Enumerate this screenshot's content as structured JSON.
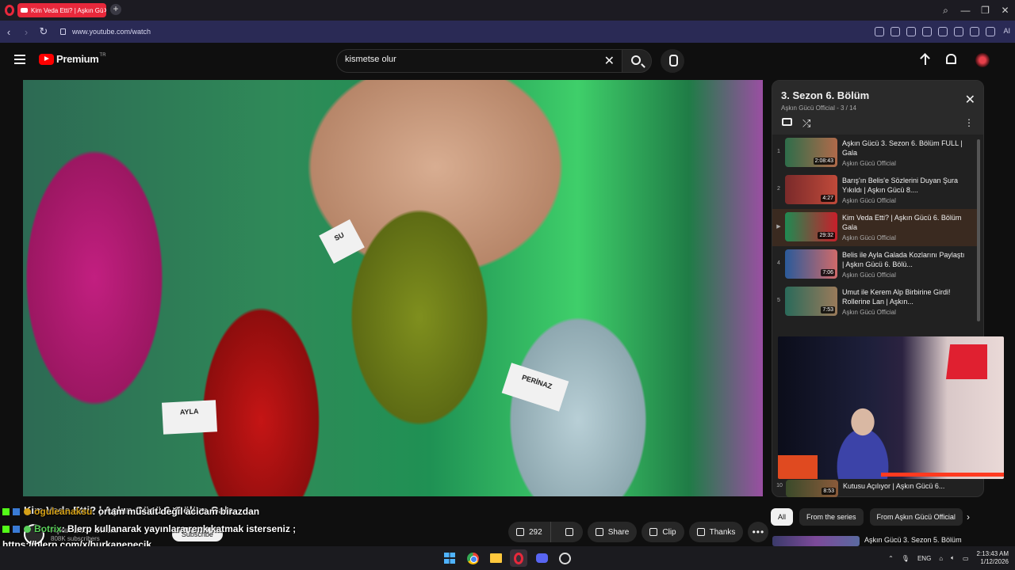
{
  "browser": {
    "tab_title": "Kim Veda Etti? | Aşkın Gü",
    "url": "www.youtube.com/watch",
    "ai_label": "AI"
  },
  "header": {
    "logo_text": "Premium",
    "logo_region": "TR",
    "search_value": "kismetse olur"
  },
  "video": {
    "name_tags": [
      "AYLA",
      "PERİNAZ",
      "SU"
    ],
    "title": "Kim Veda Etti? | Aşkın Gücü 6. Bölüm Gala",
    "channel_name": "Aşkın Gücü Official",
    "subscribers": "808K subscribers",
    "subscribe_label": "Subscribe"
  },
  "chat": [
    {
      "user": "oguleanaksu",
      "message": ": ortam müsait değil acicam birazdan"
    },
    {
      "user": "Botrix",
      "message": ": Blerp kullanarak yayınlara renk katmak isterseniz ;"
    }
  ],
  "chat_link": "https://blerp.com/x/hurkanepecik",
  "actions": {
    "like_count": "292",
    "share_label": "Share",
    "clip_label": "Clip",
    "thanks_label": "Thanks"
  },
  "playlist": {
    "title": "3. Sezon 6. Bölüm",
    "subtitle": "Aşkın Gücü Official - 3 / 14",
    "items": [
      {
        "index": "1",
        "title": "Aşkın Gücü 3. Sezon 6. Bölüm FULL | Gala",
        "channel": "Aşkın Gücü Official",
        "duration": "2:08:43",
        "colors": [
          "#2e6d4a",
          "#b06a4a"
        ],
        "active": false
      },
      {
        "index": "2",
        "title": "Barış'ın Belis'e Sözlerini Duyan Şura Yıkıldı | Aşkın Gücü 8....",
        "channel": "Aşkın Gücü Official",
        "duration": "4:27",
        "colors": [
          "#7a2a2a",
          "#c04a3a"
        ],
        "active": false
      },
      {
        "index": "▶",
        "title": "Kim Veda Etti? | Aşkın Gücü 6. Bölüm Gala",
        "channel": "Aşkın Gücü Official",
        "duration": "29:32",
        "colors": [
          "#1f8a52",
          "#c81f2a"
        ],
        "active": true
      },
      {
        "index": "4",
        "title": "Belis ile Ayla Galada Kozlarını Paylaştı | Aşkın Gücü 6. Bölü...",
        "channel": "Aşkın Gücü Official",
        "duration": "7:06",
        "colors": [
          "#2a5a9a",
          "#d06a6a"
        ],
        "active": false
      },
      {
        "index": "5",
        "title": "Umut ile Kerem Alp Birbirine Girdi! Rollerine Lan | Aşkın...",
        "channel": "Aşkın Gücü Official",
        "duration": "7:53",
        "colors": [
          "#2a6a5a",
          "#9a7a5a"
        ],
        "active": false
      }
    ],
    "bottom_item": {
      "index": "10",
      "title": "Kutusu Açılıyor | Aşkın Gücü 6...",
      "duration": "8:53"
    }
  },
  "chips": [
    "All",
    "From the series",
    "From Aşkın Gücü Official"
  ],
  "next_recommendation": "Aşkın Gücü 3. Sezon 5. Bölüm",
  "taskbar": {
    "language": "ENG",
    "time": "2:13:43 AM",
    "date": "1/12/2026"
  }
}
